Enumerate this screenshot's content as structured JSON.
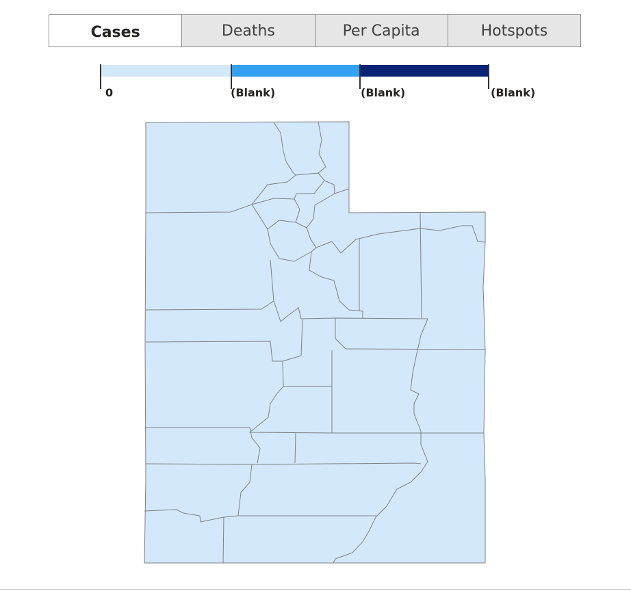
{
  "tabs": {
    "cases": "Cases",
    "deaths": "Deaths",
    "per_capita": "Per Capita",
    "hotspots": "Hotspots",
    "active": "cases"
  },
  "legend": {
    "labels": [
      "0",
      "(Blank)",
      "(Blank)",
      "(Blank)"
    ],
    "colors": [
      "#d3e8fb",
      "#33a0f2",
      "#0a2475"
    ]
  },
  "map": {
    "region_fill": "#d3e8fb",
    "border_color": "#808080"
  }
}
